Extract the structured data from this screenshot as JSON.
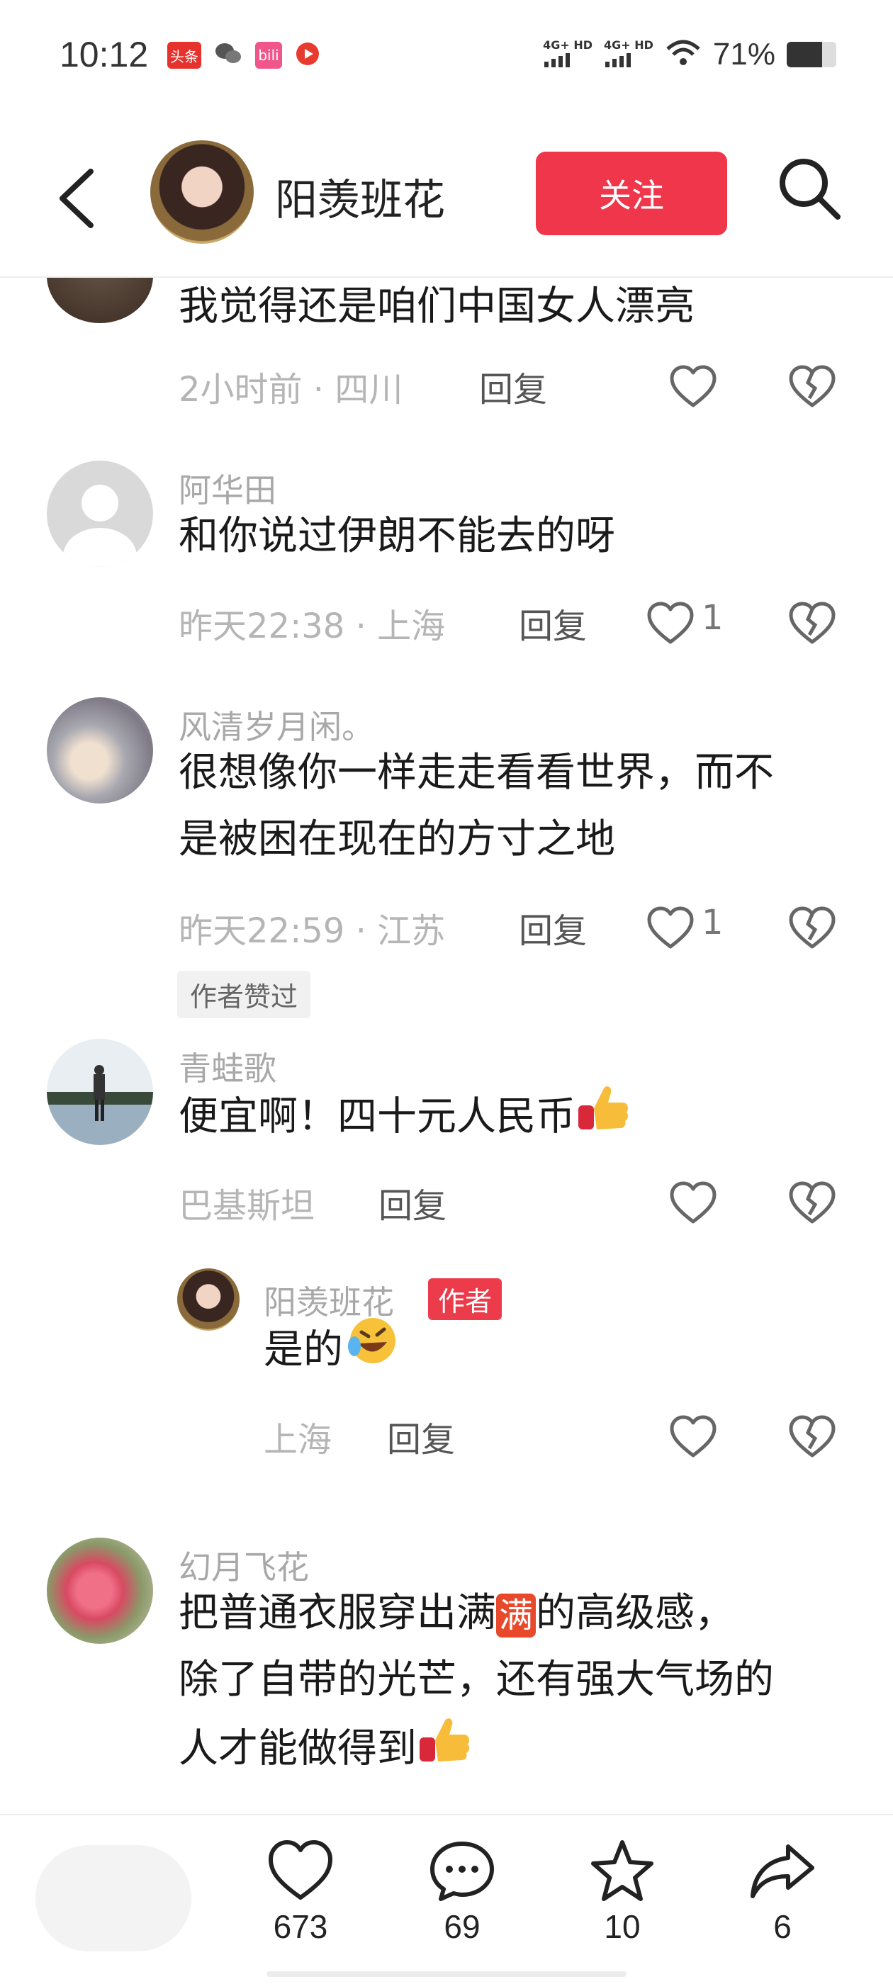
{
  "status_bar": {
    "time": "10:12",
    "apps": [
      {
        "icon": "toutiao-icon",
        "label": "头条",
        "color": "#e6322d"
      },
      {
        "icon": "wechat-icon",
        "label": "",
        "color": "#555555"
      },
      {
        "icon": "bilibili-icon",
        "label": "bili",
        "color": "#f0568a"
      },
      {
        "icon": "video-icon",
        "label": "",
        "color": "#e63b2e"
      }
    ],
    "network1": "4G+ HD",
    "network2": "4G+ HD",
    "battery": "71%",
    "battery_level": 0.71
  },
  "header": {
    "author_name": "阳羡班花",
    "follow_label": "关注"
  },
  "comments": [
    {
      "user": "",
      "text": "我觉得还是咱们中国女人漂亮",
      "meta": "2小时前 · 四川",
      "reply": "回复",
      "likes": ""
    },
    {
      "user": "阿华田",
      "text": "和你说过伊朗不能去的呀",
      "meta": "昨天22:38 · 上海",
      "reply": "回复",
      "likes": "1"
    },
    {
      "user": "风清岁月闲。",
      "text_line1": "很想像你一样走走看看世界，而不",
      "text_line2": "是被困在现在的方寸之地",
      "meta": "昨天22:59 · 江苏",
      "reply": "回复",
      "likes": "1",
      "tag": "作者赞过"
    },
    {
      "user": "青蛙歌",
      "text": "便宜啊！四十元人民币",
      "meta": "巴基斯坦",
      "reply": "回复",
      "likes": ""
    },
    {
      "user": "阳羡班花",
      "badge": "作者",
      "text": "是的",
      "meta": "上海",
      "reply": "回复",
      "likes": ""
    },
    {
      "user": "幻月飞花",
      "text_line1a": "把普通衣服穿出满",
      "text_line1_badge": "满",
      "text_line1b": "的高级感，",
      "text_line2": "除了自带的光芒，还有强大气场的",
      "text_line3": "人才能做得到"
    }
  ],
  "bottom_bar": {
    "likes": "673",
    "comments": "69",
    "favorites": "10",
    "shares": "6"
  }
}
